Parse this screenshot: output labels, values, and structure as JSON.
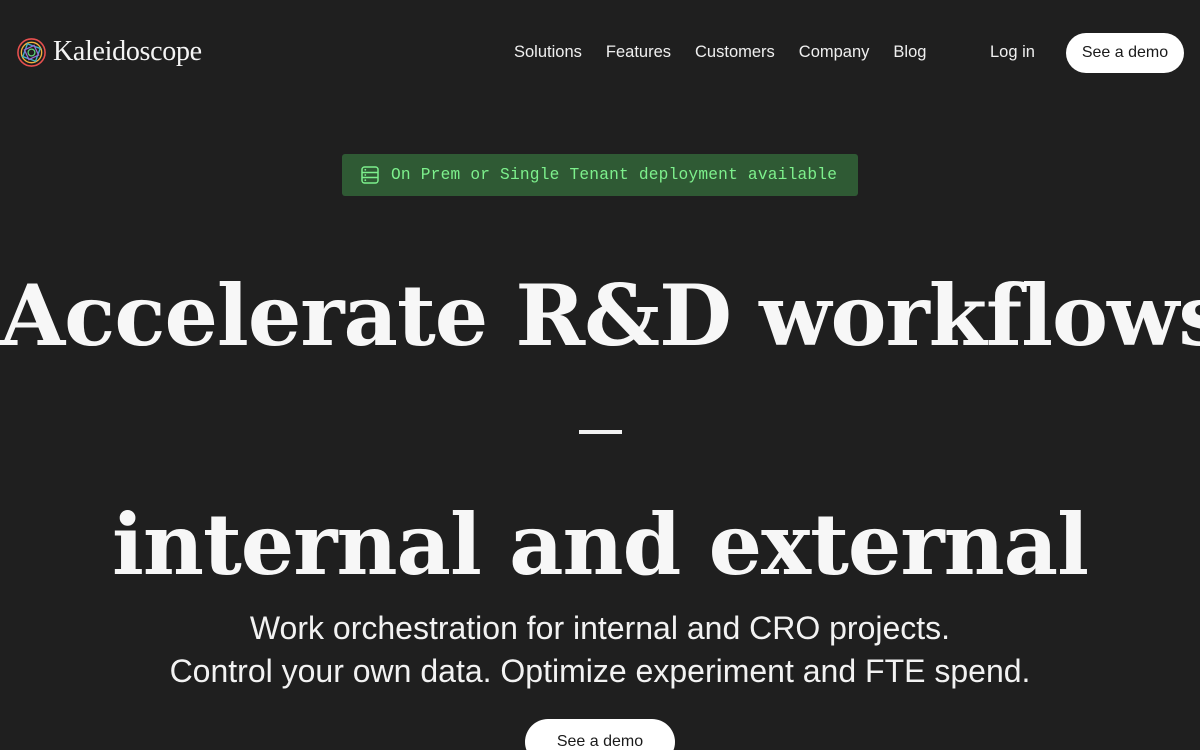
{
  "brand": {
    "name": "Kaleidoscope",
    "logo_icon": "kaleidoscope-logo-icon",
    "logo_colors": [
      "#e8504f",
      "#f2b33d",
      "#3fb6c8",
      "#9b6bd6",
      "#5ed07a"
    ]
  },
  "nav": {
    "links": [
      "Solutions",
      "Features",
      "Customers",
      "Company",
      "Blog"
    ],
    "login": "Log in",
    "cta": "See a demo"
  },
  "badge": {
    "icon": "server-icon",
    "text": "On Prem or Single Tenant deployment available",
    "color": "#7df08c",
    "background": "#2f5a34"
  },
  "hero": {
    "line1": "Accelerate R&D workflows",
    "dash": "–",
    "line2": "internal and external",
    "sub1": "Work orchestration for internal and CRO projects.",
    "sub2": "Control your own data. Optimize experiment and FTE spend.",
    "cta": "See a demo"
  },
  "colors": {
    "background": "#1f1f1f",
    "text": "#f2f2f2",
    "button_bg": "#ffffff"
  }
}
